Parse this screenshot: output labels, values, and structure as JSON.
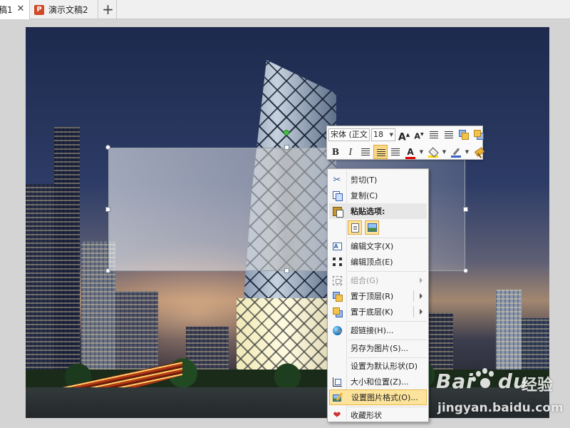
{
  "tabs": [
    {
      "label": "稿1",
      "active": true
    },
    {
      "label": "演示文稿2",
      "active": false
    }
  ],
  "tab_icon_letter": "P",
  "tab_close_glyph": "✕",
  "new_tab_glyph": "+",
  "mini_toolbar": {
    "font_name": "宋体 (正文",
    "font_size": "18",
    "bold": "B",
    "italic": "I",
    "font_color_letter": "A",
    "grow_font": "A",
    "shrink_font": "A"
  },
  "context_menu": {
    "cut": "剪切(T)",
    "copy": "复制(C)",
    "paste_options": "粘贴选项:",
    "edit_text": "编辑文字(X)",
    "edit_points": "编辑顶点(E)",
    "group": "组合(G)",
    "bring_to_front": "置于顶层(R)",
    "send_to_back": "置于底层(K)",
    "hyperlink": "超链接(H)...",
    "save_as_picture": "另存为图片(S)...",
    "set_default_shape": "设置为默认形状(D)",
    "size_position": "大小和位置(Z)...",
    "format_picture": "设置图片格式(O)...",
    "favorite_shape": "收藏形状"
  },
  "watermark": {
    "brand": "Bai",
    "brand_end": "du",
    "suffix": "经验",
    "url": "jingyan.baidu.com"
  },
  "colors": {
    "font_color": "#e00000",
    "fill_color": "#ffd700",
    "line_color": "#3b64c8",
    "menu_highlight": "#fde49c",
    "ppt_icon": "#d24726"
  },
  "icons": {
    "cut": "scissors-icon",
    "copy": "copy-icon",
    "paste": "clipboard-icon",
    "edit_text": "text-box-icon",
    "edit_points": "edit-points-icon",
    "group": "group-icon",
    "bring_to_front": "bring-front-icon",
    "send_to_back": "send-back-icon",
    "hyperlink": "globe-link-icon",
    "size_position": "size-position-icon",
    "format_picture": "format-picture-icon",
    "favorite_shape": "heart-icon"
  }
}
